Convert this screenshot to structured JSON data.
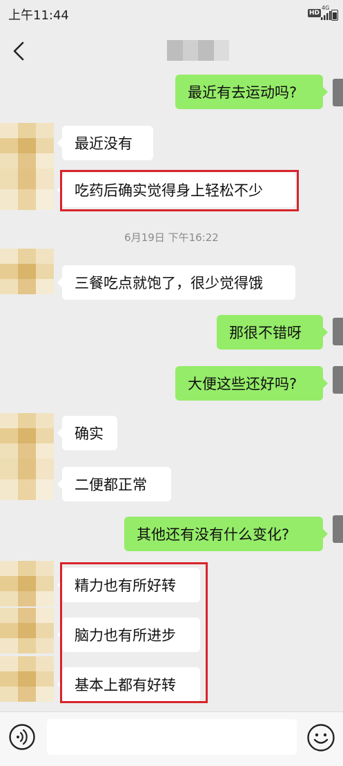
{
  "status_bar": {
    "time": "上午11:44",
    "hd_label": "HD",
    "network_label": "4G"
  },
  "header": {
    "back_icon": "chevron-left-icon",
    "contact_name_blurred": true
  },
  "messages": [
    {
      "side": "out",
      "text": "最近有去运动吗?"
    },
    {
      "side": "in",
      "text": "最近没有"
    },
    {
      "side": "in",
      "text": "吃药后确实觉得身上轻松不少",
      "highlighted": true
    },
    {
      "side": "in",
      "text": "三餐吃点就饱了，很少觉得饿"
    },
    {
      "side": "out",
      "text": "那很不错呀"
    },
    {
      "side": "out",
      "text": "大便这些还好吗?"
    },
    {
      "side": "in",
      "text": "确实"
    },
    {
      "side": "in",
      "text": "二便都正常"
    },
    {
      "side": "out",
      "text": "其他还有没有什么变化?"
    },
    {
      "side": "in",
      "text": "精力也有所好转",
      "highlighted": true
    },
    {
      "side": "in",
      "text": "脑力也有所进步",
      "highlighted": true
    },
    {
      "side": "in",
      "text": "基本上都有好转",
      "highlighted": true
    }
  ],
  "timestamp": "6月19日 下午16:22",
  "bottom_bar": {
    "voice_icon": "voice-icon",
    "emoji_icon": "emoji-icon",
    "input_value": ""
  },
  "colors": {
    "background": "#ededed",
    "outgoing_bubble": "#95ec69",
    "incoming_bubble": "#ffffff",
    "highlight_border": "#d8232a"
  }
}
